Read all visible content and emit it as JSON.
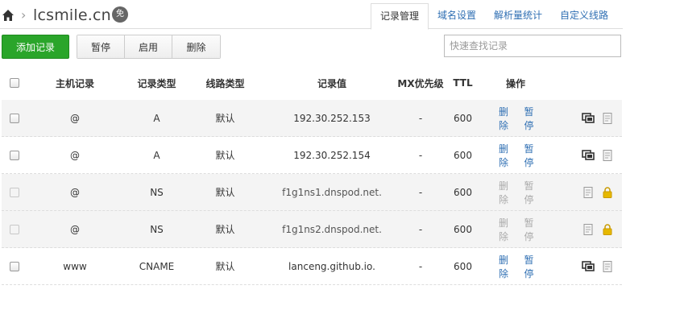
{
  "header": {
    "domain": "lcsmile.cn",
    "badge": "免",
    "tabs": [
      {
        "label": "记录管理",
        "active": true
      },
      {
        "label": "域名设置",
        "active": false
      },
      {
        "label": "解析量统计",
        "active": false
      },
      {
        "label": "自定义线路",
        "active": false
      }
    ]
  },
  "toolbar": {
    "add_label": "添加记录",
    "pause_label": "暂停",
    "enable_label": "启用",
    "delete_label": "删除",
    "search_placeholder": "快速查找记录"
  },
  "table": {
    "columns": [
      "主机记录",
      "记录类型",
      "线路类型",
      "记录值",
      "MX优先级",
      "TTL",
      "操作"
    ],
    "rows": [
      {
        "host": "@",
        "type": "A",
        "line": "默认",
        "value": "192.30.252.153",
        "mx": "-",
        "ttl": "600",
        "delete": "删除",
        "pause": "暂停",
        "locked": false
      },
      {
        "host": "@",
        "type": "A",
        "line": "默认",
        "value": "192.30.252.154",
        "mx": "-",
        "ttl": "600",
        "delete": "删除",
        "pause": "暂停",
        "locked": false
      },
      {
        "host": "@",
        "type": "NS",
        "line": "默认",
        "value": "f1g1ns1.dnspod.net.",
        "mx": "-",
        "ttl": "600",
        "delete": "删除",
        "pause": "暂停",
        "locked": true
      },
      {
        "host": "@",
        "type": "NS",
        "line": "默认",
        "value": "f1g1ns2.dnspod.net.",
        "mx": "-",
        "ttl": "600",
        "delete": "删除",
        "pause": "暂停",
        "locked": true
      },
      {
        "host": "www",
        "type": "CNAME",
        "line": "默认",
        "value": "lanceng.github.io.",
        "mx": "-",
        "ttl": "600",
        "delete": "删除",
        "pause": "暂停",
        "locked": false
      }
    ]
  },
  "colors": {
    "add_button": "#2aa52a",
    "link": "#2f6fb3",
    "lock": "#e6b800"
  },
  "icons": [
    "home-icon",
    "copy-records-icon",
    "note-icon",
    "lock-icon"
  ]
}
